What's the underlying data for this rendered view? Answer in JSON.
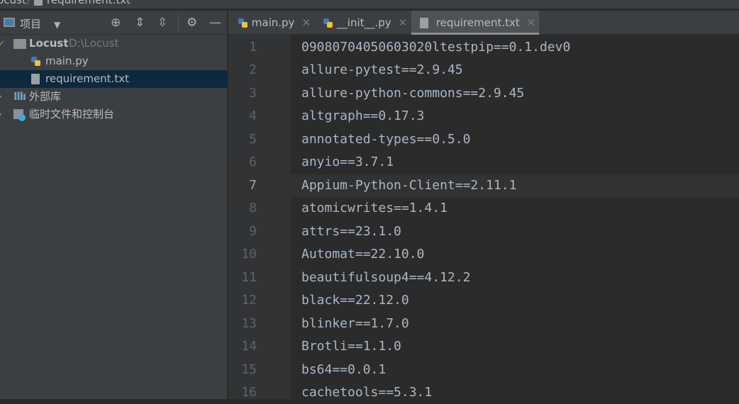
{
  "breadcrumb": {
    "project": "Locust",
    "file": "requirement.txt"
  },
  "sidebar": {
    "view_label": "项目",
    "tree": [
      {
        "name": "Locust",
        "path": "D:\\Locust",
        "type": "folder"
      },
      {
        "name": "main.py",
        "type": "python"
      },
      {
        "name": "requirement.txt",
        "type": "text",
        "selected": true
      },
      {
        "name": "外部库",
        "type": "library"
      },
      {
        "name": "临时文件和控制台",
        "type": "scratch"
      }
    ]
  },
  "tabs": [
    {
      "label": "main.py",
      "type": "python"
    },
    {
      "label": "__init__.py",
      "type": "python"
    },
    {
      "label": "requirement.txt",
      "type": "text",
      "active": true
    }
  ],
  "editor": {
    "current_line": 7,
    "lines": [
      {
        "n": "1",
        "t": "09080704050603020ltestpip==0.1.dev0"
      },
      {
        "n": "2",
        "t": "allure-pytest==2.9.45"
      },
      {
        "n": "3",
        "t": "allure-python-commons==2.9.45"
      },
      {
        "n": "4",
        "t": "altgraph==0.17.3"
      },
      {
        "n": "5",
        "t": "annotated-types==0.5.0"
      },
      {
        "n": "6",
        "t": "anyio==3.7.1"
      },
      {
        "n": "7",
        "t": "Appium-Python-Client==2.11.1"
      },
      {
        "n": "8",
        "t": "atomicwrites==1.4.1"
      },
      {
        "n": "9",
        "t": "attrs==23.1.0"
      },
      {
        "n": "10",
        "t": "Automat==22.10.0"
      },
      {
        "n": "11",
        "t": "beautifulsoup4==4.12.2"
      },
      {
        "n": "12",
        "t": "black==22.12.0"
      },
      {
        "n": "13",
        "t": "blinker==1.7.0"
      },
      {
        "n": "14",
        "t": "Brotli==1.1.0"
      },
      {
        "n": "15",
        "t": "bs64==0.0.1"
      },
      {
        "n": "16",
        "t": "cachetools==5.3.1"
      }
    ]
  }
}
